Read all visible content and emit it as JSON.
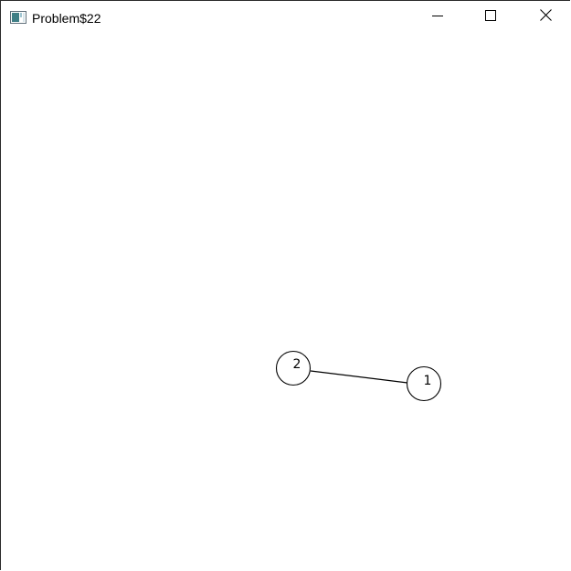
{
  "window": {
    "title": "Problem$22",
    "icon": "application-window-icon",
    "controls": {
      "minimize": "minimize-icon",
      "maximize": "maximize-icon",
      "close": "close-icon"
    }
  },
  "graph": {
    "nodes": [
      {
        "label": "2"
      },
      {
        "label": "1"
      }
    ],
    "edges": [
      {
        "from": "2",
        "to": "1"
      }
    ]
  },
  "colors": {
    "background": "#ffffff",
    "stroke": "#000000"
  }
}
